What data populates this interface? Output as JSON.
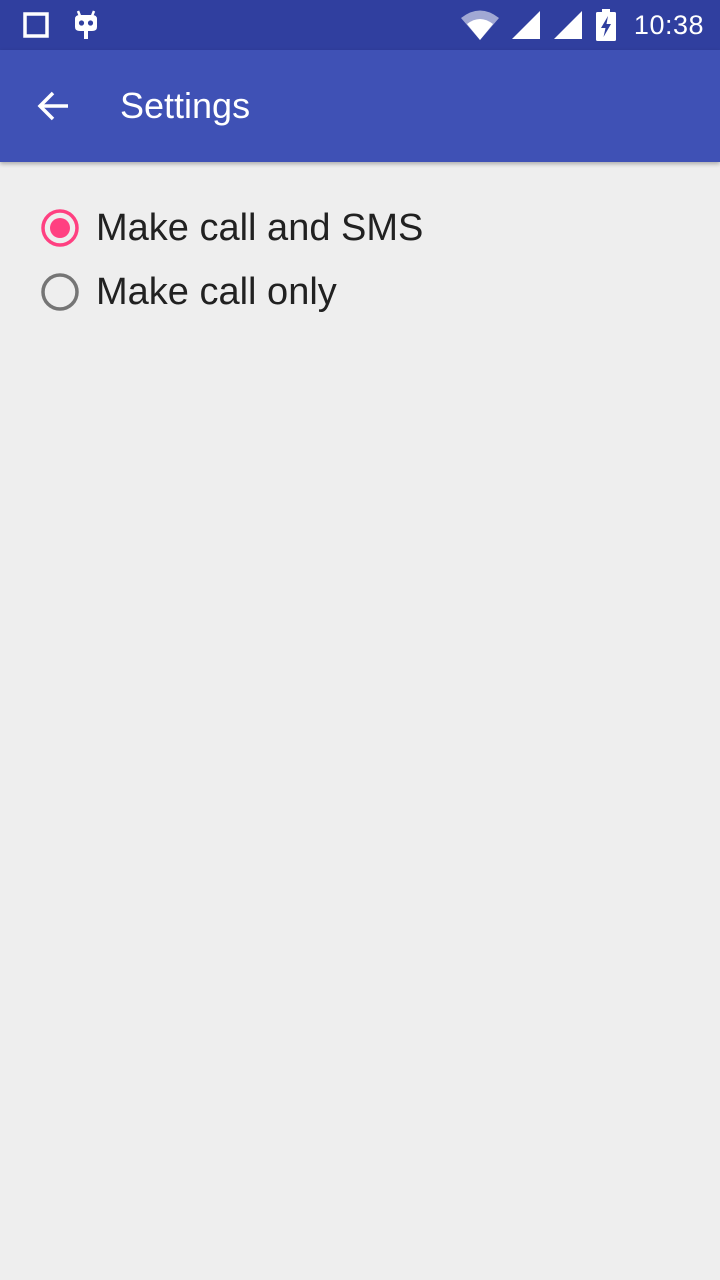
{
  "status_bar": {
    "time": "10:38",
    "icons": [
      "square-notification-icon",
      "cyanogen-mascot-icon",
      "wifi-icon",
      "cell-signal-icon",
      "cell-signal-icon",
      "battery-charging-icon"
    ]
  },
  "toolbar": {
    "back_icon": "arrow-back-icon",
    "title": "Settings"
  },
  "options": [
    {
      "label": "Make call and SMS",
      "selected": true
    },
    {
      "label": "Make call only",
      "selected": false
    }
  ],
  "colors": {
    "status_bar": "#303f9f",
    "toolbar": "#3f51b5",
    "accent": "#ff4081",
    "radio_unchecked": "#757575",
    "background": "#eeeeee"
  }
}
